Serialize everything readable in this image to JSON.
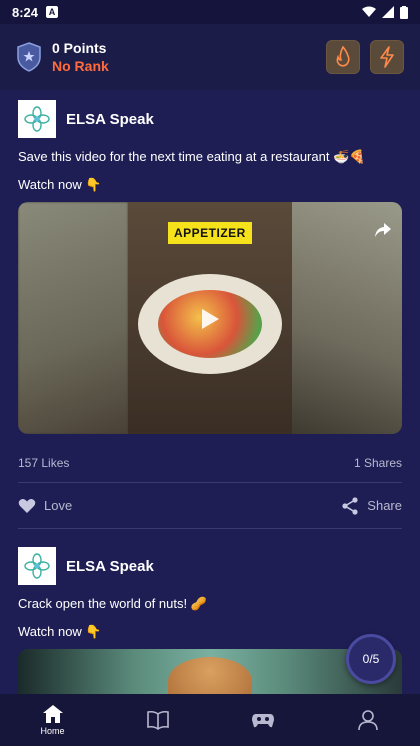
{
  "status_bar": {
    "time": "8:24",
    "a_badge": "A"
  },
  "header": {
    "points": "0 Points",
    "rank": "No Rank"
  },
  "posts": [
    {
      "brand": "ELSA Speak",
      "caption": "Save this video for the next time eating at a restaurant 🍜🍕",
      "watch": "Watch now 👇",
      "overlay_label": "APPETIZER",
      "likes": "157 Likes",
      "shares": "1 Shares",
      "love_label": "Love",
      "share_label": "Share"
    },
    {
      "brand": "ELSA Speak",
      "caption": "Crack open the world of nuts! 🥜",
      "watch": "Watch now 👇"
    }
  ],
  "progress": {
    "label": "0/5"
  },
  "nav": {
    "home_label": "Home"
  },
  "colors": {
    "accent": "#ff6b3d",
    "background": "#1e1e55",
    "header": "#1c1c48"
  }
}
